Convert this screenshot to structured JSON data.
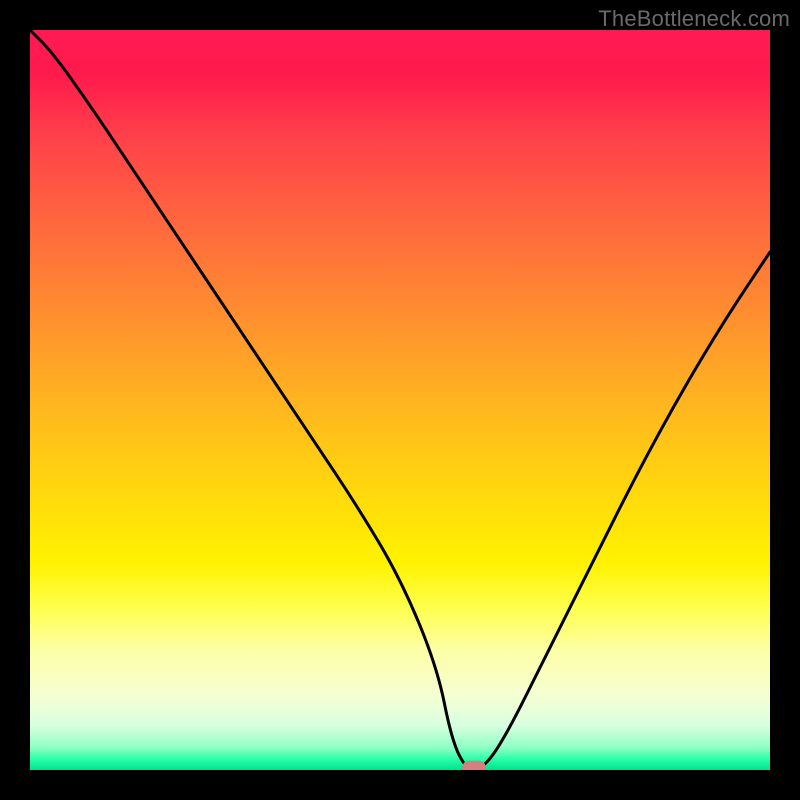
{
  "watermark": "TheBottleneck.com",
  "chart_data": {
    "type": "line",
    "title": "",
    "xlabel": "",
    "ylabel": "",
    "xlim": [
      0,
      100
    ],
    "ylim": [
      0,
      100
    ],
    "grid": false,
    "legend": false,
    "gradient_stops": [
      {
        "pct": 0,
        "color": "#ff1a53"
      },
      {
        "pct": 6,
        "color": "#ff1a4c"
      },
      {
        "pct": 14,
        "color": "#ff3f4a"
      },
      {
        "pct": 26,
        "color": "#ff673e"
      },
      {
        "pct": 38,
        "color": "#ff8d30"
      },
      {
        "pct": 50,
        "color": "#ffb420"
      },
      {
        "pct": 62,
        "color": "#ffd70e"
      },
      {
        "pct": 72,
        "color": "#fff200"
      },
      {
        "pct": 78,
        "color": "#feff4d"
      },
      {
        "pct": 84,
        "color": "#fcffa8"
      },
      {
        "pct": 90,
        "color": "#f5ffd4"
      },
      {
        "pct": 94,
        "color": "#d7ffdf"
      },
      {
        "pct": 97,
        "color": "#8cffc3"
      },
      {
        "pct": 98.5,
        "color": "#2affaa"
      },
      {
        "pct": 100,
        "color": "#00e28e"
      }
    ],
    "series": [
      {
        "name": "bottleneck-curve",
        "x": [
          0,
          3,
          8,
          14,
          20,
          26,
          32,
          38,
          44,
          50,
          55,
          57,
          59,
          61,
          64,
          70,
          76,
          82,
          88,
          94,
          100
        ],
        "y": [
          100,
          97,
          90,
          81,
          72,
          63,
          54,
          45,
          36,
          26,
          14,
          4,
          0,
          0,
          4,
          16,
          28,
          40,
          51,
          61,
          70
        ]
      }
    ],
    "marker": {
      "name": "bottleneck-marker",
      "x": 60,
      "y": 0,
      "width_pct": 3.2,
      "height_pct": 2.0,
      "color": "#d67f7f"
    }
  }
}
